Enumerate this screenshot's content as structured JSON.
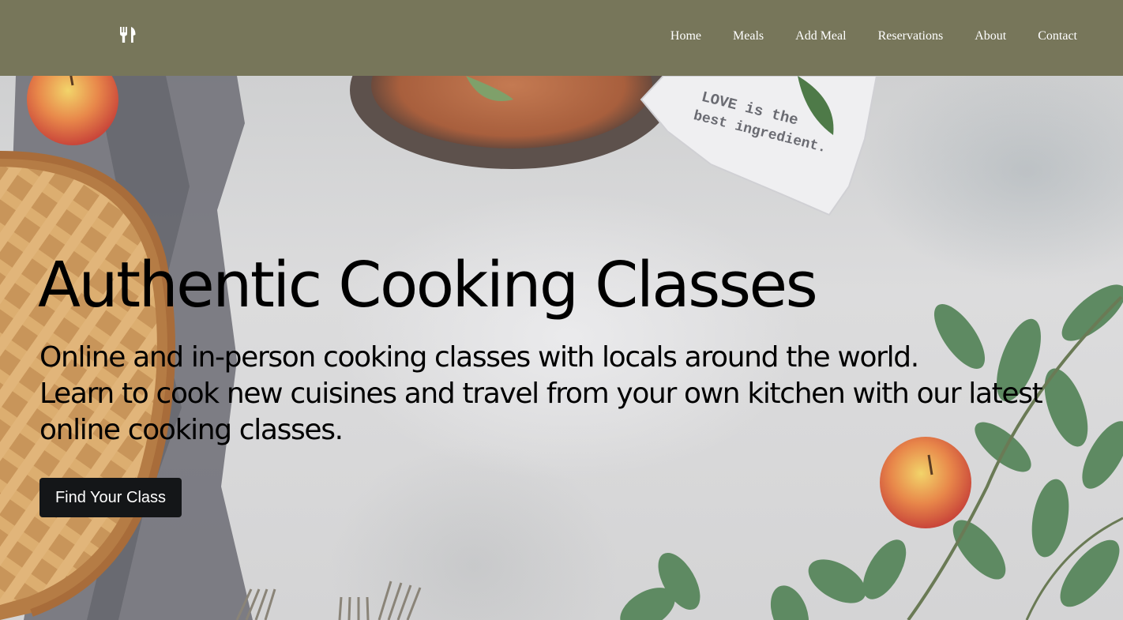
{
  "colors": {
    "navbar_bg": "#77765a",
    "nav_text": "#ffffff",
    "cta_bg": "#141618",
    "cta_text": "#ffffff"
  },
  "logo": {
    "icon": "fork-knife-icon"
  },
  "nav": {
    "items": [
      {
        "label": "Home"
      },
      {
        "label": "Meals"
      },
      {
        "label": "Add Meal"
      },
      {
        "label": "Reservations"
      },
      {
        "label": "About"
      },
      {
        "label": "Contact"
      }
    ]
  },
  "hero": {
    "title": "Authentic Cooking Classes",
    "line1": "Online and in-person cooking classes with locals around the world.",
    "line2": "Learn to cook new cuisines and travel from your own kitchen with our latest online cooking classes.",
    "cta_label": "Find Your Class",
    "towel_text_line1": "LOVE is the",
    "towel_text_line2": "best ingredient."
  }
}
